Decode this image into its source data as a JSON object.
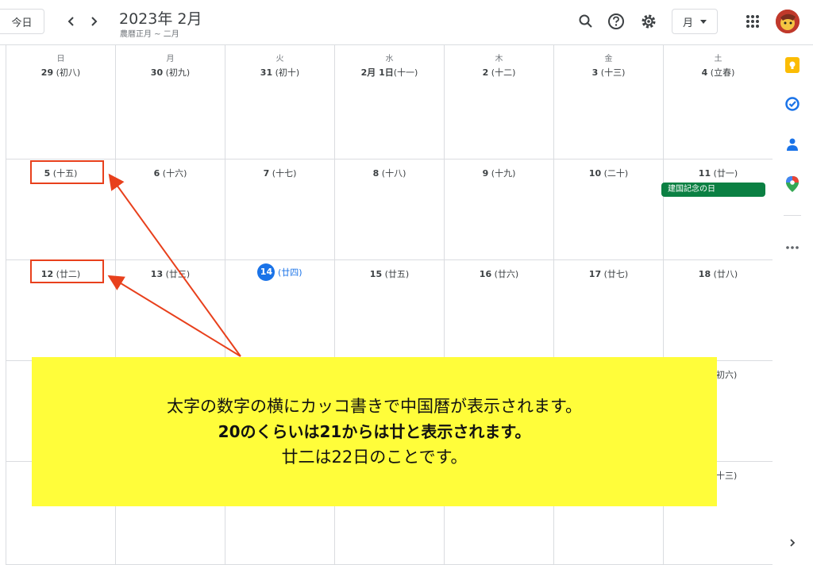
{
  "header": {
    "today_label": "今日",
    "title": "2023年 2月",
    "subtitle": "農暦正月 ~ 二月",
    "view_label": "月"
  },
  "weekdays": [
    "日",
    "月",
    "火",
    "水",
    "木",
    "金",
    "土"
  ],
  "week1": [
    {
      "day": "29",
      "lunar": "(初八)"
    },
    {
      "day": "30",
      "lunar": "(初九)"
    },
    {
      "day": "31",
      "lunar": "(初十)"
    },
    {
      "day": "2月 1日",
      "lunar": "(十一)"
    },
    {
      "day": "2",
      "lunar": "(十二)"
    },
    {
      "day": "3",
      "lunar": "(十三)"
    },
    {
      "day": "4",
      "lunar": "(立春)"
    }
  ],
  "week2": [
    {
      "day": "5",
      "lunar": "(十五)"
    },
    {
      "day": "6",
      "lunar": "(十六)"
    },
    {
      "day": "7",
      "lunar": "(十七)"
    },
    {
      "day": "8",
      "lunar": "(十八)"
    },
    {
      "day": "9",
      "lunar": "(十九)"
    },
    {
      "day": "10",
      "lunar": "(二十)"
    },
    {
      "day": "11",
      "lunar": "(廿一)"
    }
  ],
  "week3": [
    {
      "day": "12",
      "lunar": "(廿二)"
    },
    {
      "day": "13",
      "lunar": "(廿三)"
    },
    {
      "day": "14",
      "lunar": "(廿四)"
    },
    {
      "day": "15",
      "lunar": "(廿五)"
    },
    {
      "day": "16",
      "lunar": "(廿六)"
    },
    {
      "day": "17",
      "lunar": "(廿七)"
    },
    {
      "day": "18",
      "lunar": "(廿八)"
    }
  ],
  "week4_sat_partial": "初六)",
  "week5_sat_partial": "十三)",
  "event": {
    "title": "建国記念の日",
    "color": "#0b8043"
  },
  "annotation": {
    "line1": "太字の数字の横にカッコ書きで中国暦が表示されます。",
    "line2": "20のくらいは21からは廿と表示されます。",
    "line3": "廿二は22日のことです。",
    "box_color": "#fffd3a",
    "arrow_color": "#e8401c"
  },
  "colors": {
    "today_accent": "#1a73e8",
    "border": "#dadce0"
  },
  "icons": {
    "header": [
      "chevron-left-icon",
      "chevron-right-icon",
      "search-icon",
      "help-icon",
      "settings-icon",
      "apps-icon"
    ],
    "side": [
      "keep-icon",
      "tasks-icon",
      "contacts-icon",
      "maps-icon",
      "more-icon",
      "expand-icon"
    ]
  }
}
